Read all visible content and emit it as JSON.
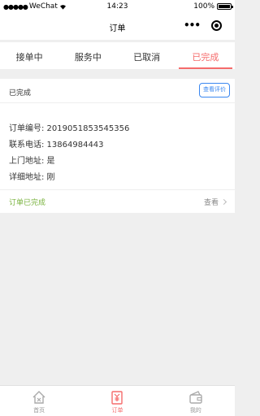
{
  "status_bar": {
    "carrier": "WeChat",
    "time": "14:23",
    "battery": "100%",
    "battery_level": 1.0
  },
  "nav": {
    "title": "订单"
  },
  "tabs": [
    {
      "label": "接单中"
    },
    {
      "label": "服务中"
    },
    {
      "label": "已取消"
    },
    {
      "label": "已完成"
    }
  ],
  "active_tab": 3,
  "order": {
    "status": "已完成",
    "review_button": "查看评价",
    "number_line": "订单编号: 2019051853545356",
    "phone_line": "联系电话: 13864984443",
    "onsite_line": "上门地址: 是",
    "address_line": "详细地址: 刚",
    "footer_status": "订单已完成",
    "view_label": "查看"
  },
  "tabbar": [
    {
      "label": "首页",
      "icon": "home-icon"
    },
    {
      "label": "订单",
      "icon": "order-icon"
    },
    {
      "label": "我的",
      "icon": "wallet-icon"
    }
  ],
  "colors": {
    "accent": "#f56b6b",
    "link": "#3a87f0",
    "success": "#7ab33f"
  }
}
